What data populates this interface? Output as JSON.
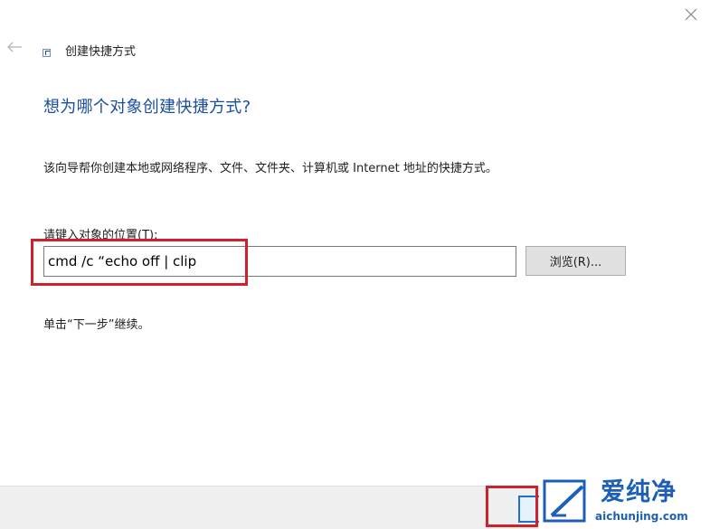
{
  "window": {
    "title": "创建快捷方式"
  },
  "icons": {
    "back": "back-arrow-icon",
    "close": "close-icon",
    "shortcut": "shortcut-icon"
  },
  "main": {
    "heading": "想为哪个对象创建快捷方式?",
    "description": "该向导帮你创建本地或网络程序、文件、文件夹、计算机或 Internet 地址的快捷方式。",
    "field_label": "请键入对象的位置(T):",
    "location_value": "cmd /c “echo off | clip",
    "browse_label": "浏览(R)...",
    "hint": "单击“下一步”继续。"
  },
  "watermark": {
    "brand": "爱纯净",
    "url": "aichunjing.com"
  },
  "colors": {
    "heading": "#1b4e9c",
    "highlight": "#d0202e",
    "footer": "#f0f0f0",
    "brand": "#1d5fb8"
  }
}
